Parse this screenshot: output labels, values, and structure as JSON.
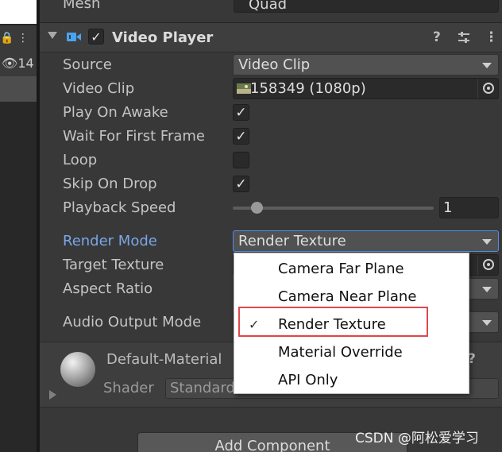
{
  "left_panel": {
    "row1_icons": "🔒 ⋮",
    "row2_text": "👁14"
  },
  "mesh": {
    "label": "Mesh",
    "value": "Quad"
  },
  "component": {
    "title": "Video Player",
    "enabled": true
  },
  "properties": {
    "source": {
      "label": "Source",
      "value": "Video Clip"
    },
    "video_clip": {
      "label": "Video Clip",
      "value": "158349 (1080p)"
    },
    "play_on_awake": {
      "label": "Play On Awake",
      "checked": true
    },
    "wait_first_frame": {
      "label": "Wait For First Frame",
      "checked": true
    },
    "loop": {
      "label": "Loop",
      "checked": false
    },
    "skip_on_drop": {
      "label": "Skip On Drop",
      "checked": true
    },
    "playback_speed": {
      "label": "Playback Speed",
      "value": "1"
    },
    "render_mode": {
      "label": "Render Mode",
      "value": "Render Texture"
    },
    "target_texture": {
      "label": "Target Texture"
    },
    "aspect_ratio": {
      "label": "Aspect Ratio"
    },
    "audio_output_mode": {
      "label": "Audio Output Mode"
    }
  },
  "material": {
    "name": "Default-Material",
    "shader_label": "Shader",
    "shader_value": "Standard"
  },
  "add_component_label": "Add Component",
  "render_mode_menu": {
    "options": [
      "Camera Far Plane",
      "Camera Near Plane",
      "Render Texture",
      "Material Override",
      "API Only"
    ],
    "selected": "Render Texture"
  },
  "watermark": "CSDN @阿松爱学习"
}
